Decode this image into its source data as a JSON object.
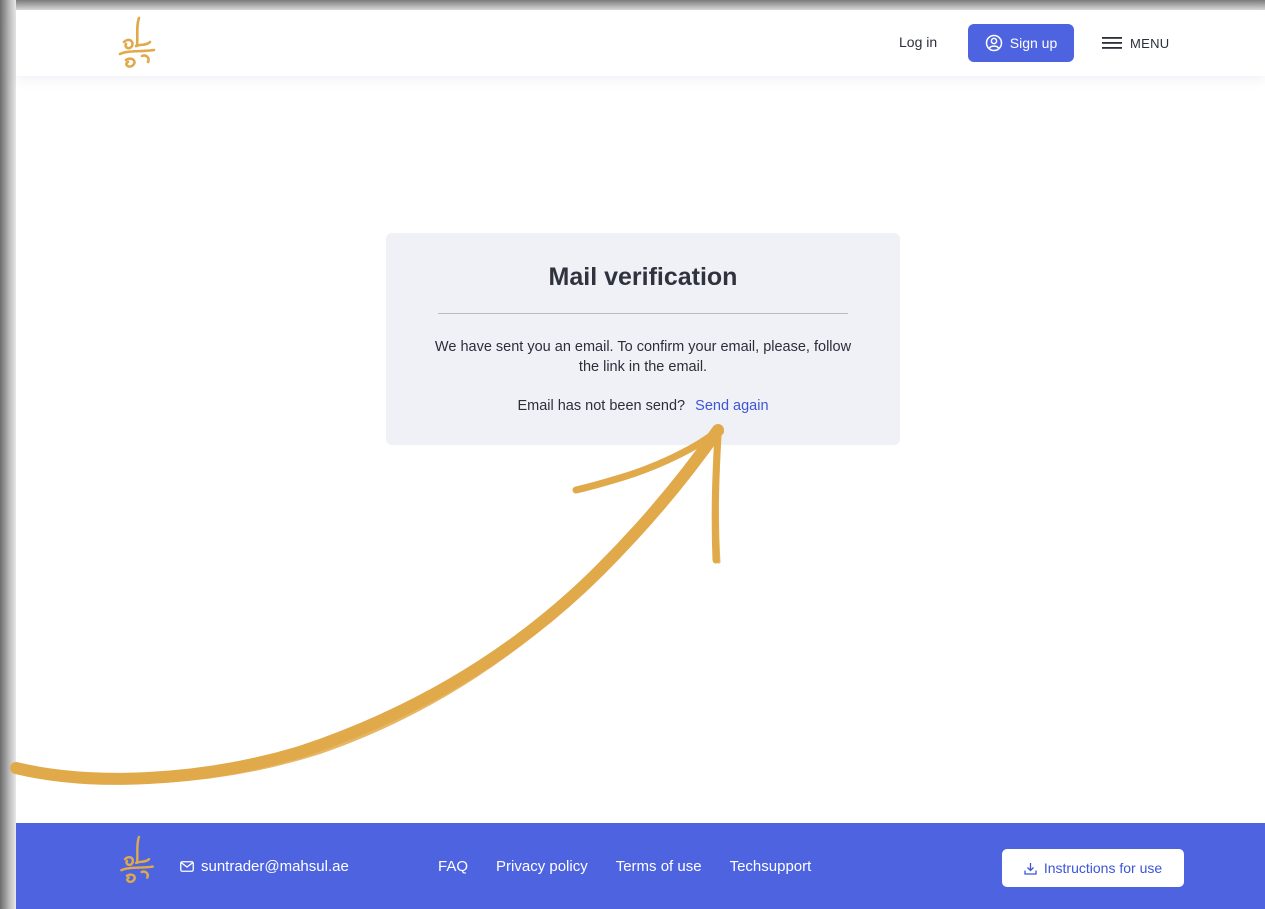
{
  "brand": {
    "logo_icon": "golden-calligraphy-logo-icon",
    "accent_color": "#4d63e0",
    "logo_color": "#e0a94a"
  },
  "header": {
    "login_label": "Log in",
    "signup_label": "Sign up",
    "signup_icon": "user-circle-icon",
    "menu_label": "MENU",
    "menu_icon": "hamburger-icon"
  },
  "card": {
    "title": "Mail verification",
    "message": "We have sent you an email. To confirm your email, please, follow the link in the email.",
    "resend_prompt": "Email has not been send?",
    "resend_link": "Send again",
    "background": "#f0f1f6"
  },
  "annotation": {
    "arrow_icon": "hand-drawn-arrow-icon",
    "color": "#e0a94a"
  },
  "footer": {
    "email": "suntrader@mahsul.ae",
    "email_icon": "mail-icon",
    "links": [
      "FAQ",
      "Privacy policy",
      "Terms of use",
      "Techsupport"
    ],
    "instructions_label": "Instructions for use",
    "instructions_icon": "download-icon"
  }
}
